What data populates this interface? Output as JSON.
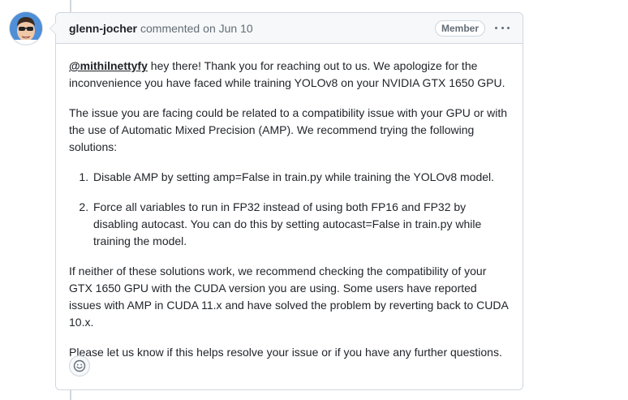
{
  "comment": {
    "author": "glenn-jocher",
    "action_text": "commented",
    "timestamp": "on Jun 10",
    "role_badge": "Member",
    "menu_icon": "kebab-horizontal-icon",
    "avatar_icon": "user-avatar",
    "body": {
      "intro_mention": "@mithilnettyfy",
      "intro_text": " hey there! Thank you for reaching out to us. We apologize for the inconvenience you have faced while training YOLOv8 on your NVIDIA GTX 1650 GPU.",
      "paragraph_2": "The issue you are facing could be related to a compatibility issue with your GPU or with the use of Automatic Mixed Precision (AMP). We recommend trying the following solutions:",
      "solutions": [
        "Disable AMP by setting amp=False in train.py while training the YOLOv8 model.",
        "Force all variables to run in FP32 instead of using both FP16 and FP32 by disabling autocast. You can do this by setting autocast=False in train.py while training the model."
      ],
      "paragraph_3": "If neither of these solutions work, we recommend checking the compatibility of your GTX 1650 GPU with the CUDA version you are using. Some users have reported issues with AMP in CUDA 11.x and have solved the problem by reverting back to CUDA 10.x.",
      "paragraph_4": "Please let us know if this helps resolve your issue or if you have any further questions."
    },
    "reaction_icon": "smiley-icon"
  },
  "colors": {
    "border": "#d0d7de",
    "header_bg": "#f6f8fa",
    "muted_text": "#636c76",
    "text": "#1f2328"
  }
}
